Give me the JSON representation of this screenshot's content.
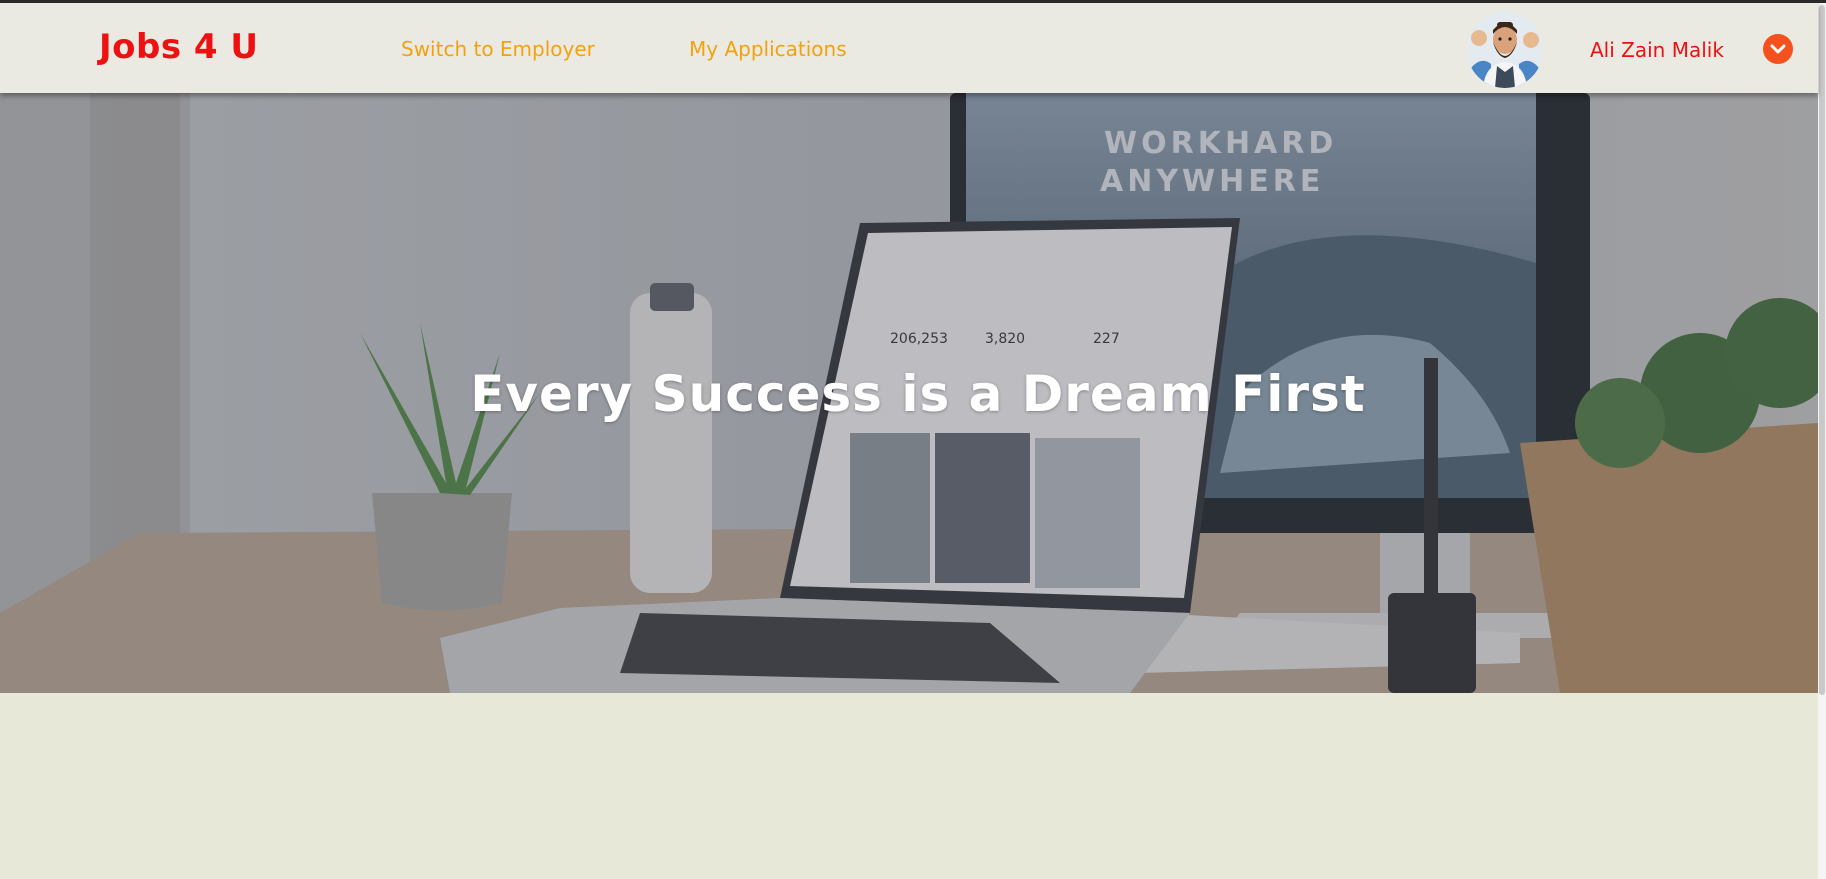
{
  "brand": {
    "logo_text": "Jobs 4 U",
    "logo_color": "#ee1111"
  },
  "nav": {
    "switch_label": "Switch to Employer",
    "applications_label": "My Applications",
    "link_color": "#f2a20c"
  },
  "user": {
    "name": "Ali Zain Malik",
    "avatar_icon": "user-avatar",
    "dropdown_icon": "chevron-down-icon",
    "accent_color": "#f4511e"
  },
  "hero": {
    "title": "Every Success is a Dream First",
    "monitor_text_line1": "WORKHARD",
    "monitor_text_line2": "ANYWHERE",
    "stats": [
      "206,253",
      "3,820",
      "227"
    ]
  }
}
